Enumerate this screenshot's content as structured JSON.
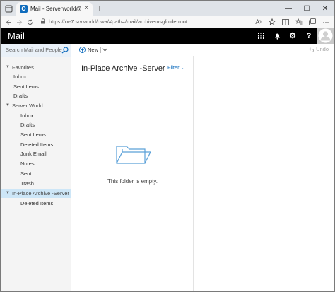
{
  "browser": {
    "tab_title": "Mail - Serverworld@srv.world",
    "favicon_letter": "O",
    "new_tab_symbol": "+",
    "close_tab_symbol": "×",
    "minimize_symbol": "—",
    "maximize_symbol": "☐",
    "close_window_symbol": "✕",
    "url": "https://rx-7.srv.world/owa/#path=/mail/archivemsgfolderroot"
  },
  "header": {
    "app_name": "Mail",
    "settings_symbol": "⚙",
    "help_symbol": "?"
  },
  "search": {
    "placeholder": "Search Mail and People"
  },
  "sidebar": {
    "favorites_label": "Favorites",
    "favorites": [
      "Inbox",
      "Sent Items",
      "Drafts"
    ],
    "account_label": "Server World",
    "account_folders": [
      "Inbox",
      "Drafts",
      "Sent Items",
      "Deleted Items",
      "Junk Email",
      "Notes",
      "Sent",
      "Trash"
    ],
    "archive_label": "In-Place Archive -Server",
    "archive_folders": [
      "Deleted Items"
    ]
  },
  "commands": {
    "new_label": "New",
    "undo_label": "Undo"
  },
  "list": {
    "folder_title": "In-Place Archive -Server World",
    "filter_label": "Filter",
    "empty_message": "This folder is empty."
  },
  "colors": {
    "accent": "#0f6cbd",
    "selected_folder_bg": "#cde6f7",
    "header_bg": "#000000"
  }
}
